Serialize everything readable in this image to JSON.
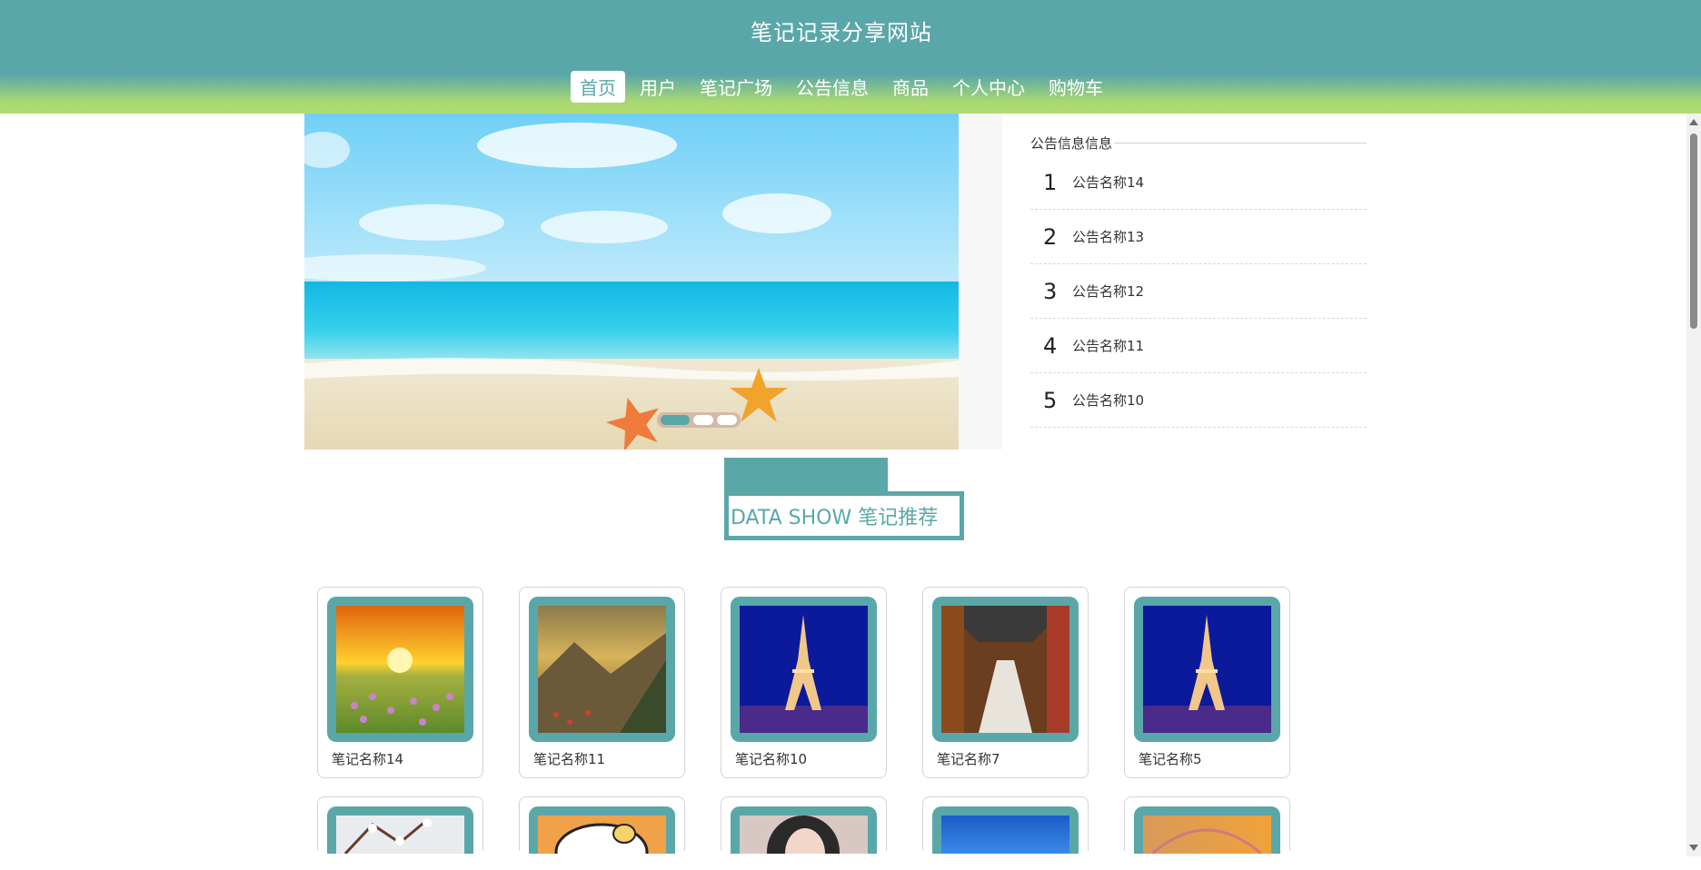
{
  "site": {
    "title": "笔记记录分享网站"
  },
  "nav": [
    {
      "label": "首页",
      "active": true
    },
    {
      "label": "用户"
    },
    {
      "label": "笔记广场"
    },
    {
      "label": "公告信息"
    },
    {
      "label": "商品"
    },
    {
      "label": "个人中心"
    },
    {
      "label": "购物车"
    }
  ],
  "notice": {
    "title": "公告信息信息",
    "items": [
      {
        "num": "1",
        "name": "公告名称14"
      },
      {
        "num": "2",
        "name": "公告名称13"
      },
      {
        "num": "3",
        "name": "公告名称12"
      },
      {
        "num": "4",
        "name": "公告名称11"
      },
      {
        "num": "5",
        "name": "公告名称10"
      }
    ]
  },
  "section": {
    "title": "DATA SHOW 笔记推荐"
  },
  "notes": [
    {
      "name": "笔记名称14",
      "image": "sunset-meadow"
    },
    {
      "name": "笔记名称11",
      "image": "mountain-valley"
    },
    {
      "name": "笔记名称10",
      "image": "eiffel-tower-night"
    },
    {
      "name": "笔记名称7",
      "image": "temple-corridor"
    },
    {
      "name": "笔记名称5",
      "image": "eiffel-tower-night"
    }
  ],
  "notes_row2": [
    {
      "image": "blossom-branch"
    },
    {
      "image": "cartoon-character"
    },
    {
      "image": "portrait-girl"
    },
    {
      "image": "blue-sky"
    },
    {
      "image": "sunset-rainbow"
    }
  ],
  "carousel": {
    "image": "beach-starfish",
    "slides": 3,
    "active_slide": 1
  },
  "colors": {
    "primary": "#5aa7a9",
    "header_bottom": "#a8d873"
  }
}
